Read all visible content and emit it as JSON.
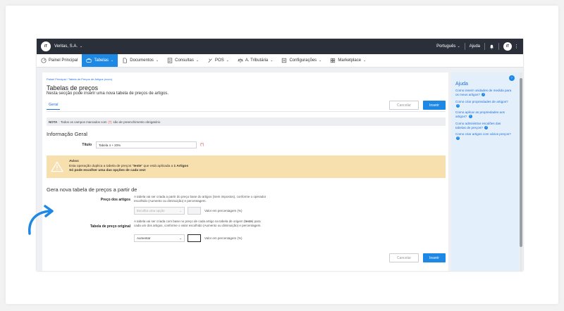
{
  "topbar": {
    "logo_text": "iT",
    "company": "Veritas, S.A.",
    "language": "Português",
    "help": "Ajuda",
    "avatar_text": "iT"
  },
  "nav": [
    {
      "label": "Painel Principal",
      "icon": "dashboard-icon"
    },
    {
      "label": "Tabelas",
      "icon": "tables-icon",
      "active": true
    },
    {
      "label": "Documentos",
      "icon": "document-icon"
    },
    {
      "label": "Consultas",
      "icon": "list-icon"
    },
    {
      "label": "POS",
      "icon": "pos-icon"
    },
    {
      "label": "A. Tributária",
      "icon": "tax-icon"
    },
    {
      "label": "Configurações",
      "icon": "gear-icon"
    },
    {
      "label": "Marketplace",
      "icon": "marketplace-icon"
    }
  ],
  "breadcrumb": "Painel Principal  /  Tabela de Preços de Artigos (novo)",
  "page": {
    "title": "Tabelas de preços",
    "subtitle": "Nesta secção pode inserir uma nova tabela de preços de artigos.",
    "tab": "Geral"
  },
  "buttons": {
    "cancel": "Cancelar",
    "insert": "Inserir"
  },
  "note": {
    "label": "NOTA",
    "text_before": ": Todos os campos marcados com",
    "marker": "(*)",
    "text_after": "são de preenchimento obrigatório"
  },
  "info": {
    "section_title": "Informação Geral",
    "title_label": "Título",
    "title_value": "Tabela 4 + 20%",
    "required": "(*)"
  },
  "warning": {
    "title": "Aviso:",
    "line1_prefix": "Esta operação duplica a tabela de preços \"",
    "line1_table": "teste",
    "line1_middle": "\" que está aplicada a ",
    "line1_count": "1 Artigos",
    "line2": "Só pode escolher uma das opções de cada vez!"
  },
  "generate": {
    "section_title": "Gera nova tabela de preços a partir de",
    "article_prices": {
      "label": "Preço dos artigos",
      "description": "A tabela vai ser criada a partir do preço base do artigos (Sem impostos), conforme o operador escolhido (Aumento ou diminuição) e percentagem.",
      "select_placeholder": "Escolha uma opção",
      "percent_label": "Valor em percentagem (%)"
    },
    "original_table": {
      "label": "Tabela de preço original",
      "description_before": "A tabela vai ser criada com base no preço de cada artigo na tabela de origem (",
      "description_table": "teste",
      "description_after": ") para cada um dos artigos, conforme o valor escolhido (Aumento ou diminuição) e percentagem.",
      "select_value": "Aumentar",
      "percent_label": "Valor em percentagem (%)"
    }
  },
  "help": {
    "title": "Ajuda",
    "items": [
      "Como inserir unidades de medida para os meus artigos?",
      "Como criar propriedades de artigos?",
      "Como aplicar as propriedades aos artigos?",
      "Como administrar escalões das tabelas de preços?",
      "Como criar artigos com vários preços?"
    ]
  },
  "colors": {
    "accent": "#1e88e5",
    "topbar": "#2b2f3a",
    "warning_bg": "#f7dfae",
    "help_bg": "#e3effb"
  }
}
